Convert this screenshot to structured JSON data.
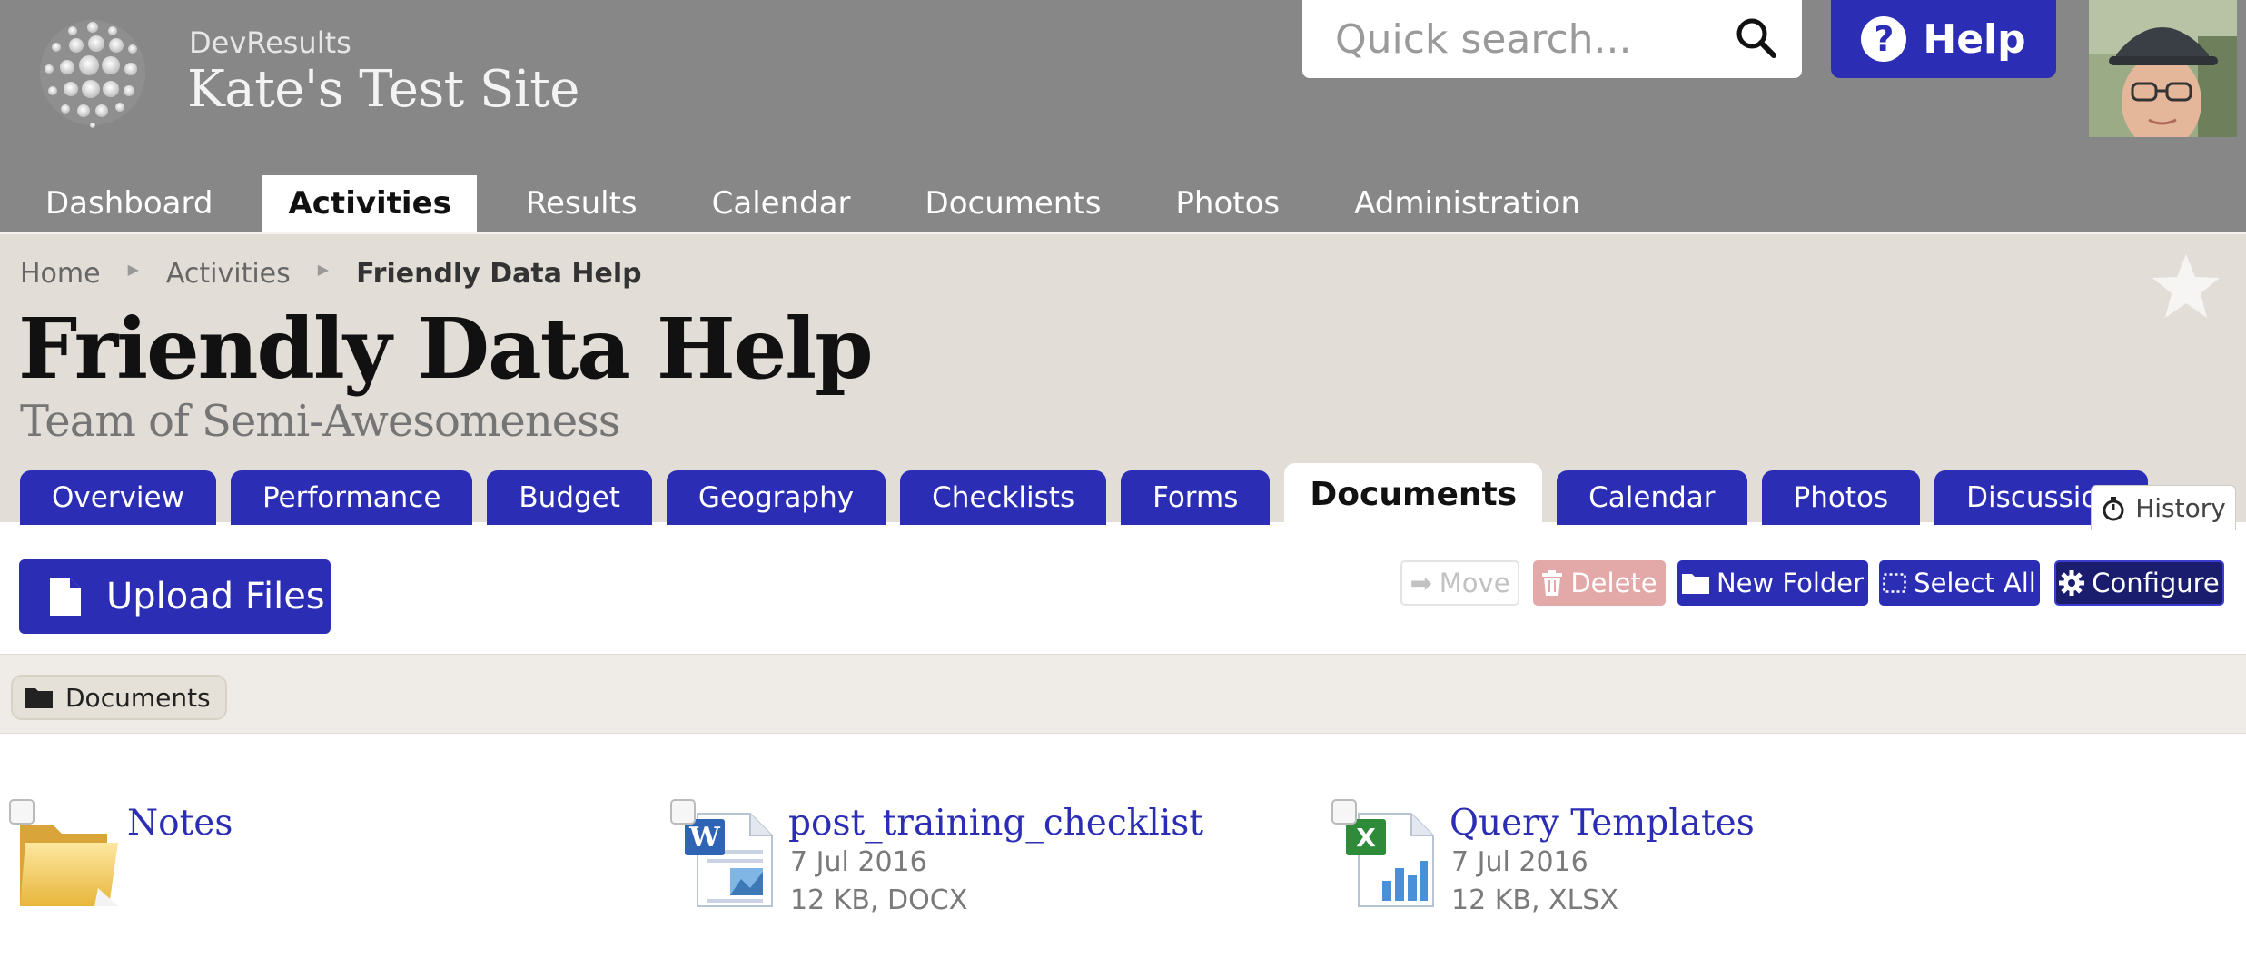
{
  "header": {
    "org_name": "DevResults",
    "site_title": "Kate's Test Site",
    "search": {
      "placeholder": "Quick search..."
    },
    "help_label": "Help"
  },
  "main_nav": [
    {
      "label": "Dashboard",
      "active": false
    },
    {
      "label": "Activities",
      "active": true
    },
    {
      "label": "Results",
      "active": false
    },
    {
      "label": "Calendar",
      "active": false
    },
    {
      "label": "Documents",
      "active": false
    },
    {
      "label": "Photos",
      "active": false
    },
    {
      "label": "Administration",
      "active": false
    }
  ],
  "breadcrumb": [
    "Home",
    "Activities",
    "Friendly Data Help"
  ],
  "page": {
    "title": "Friendly Data Help",
    "subtitle": "Team of Semi-Awesomeness"
  },
  "tabs": [
    {
      "label": "Overview",
      "active": false
    },
    {
      "label": "Performance",
      "active": false
    },
    {
      "label": "Budget",
      "active": false
    },
    {
      "label": "Geography",
      "active": false
    },
    {
      "label": "Checklists",
      "active": false
    },
    {
      "label": "Forms",
      "active": false
    },
    {
      "label": "Documents",
      "active": true
    },
    {
      "label": "Calendar",
      "active": false
    },
    {
      "label": "Photos",
      "active": false
    },
    {
      "label": "Discussion",
      "active": false
    }
  ],
  "history_label": "History",
  "toolbar": {
    "upload_label": "Upload Files",
    "move_label": "Move",
    "delete_label": "Delete",
    "new_folder_label": "New Folder",
    "select_all_label": "Select All",
    "configure_label": "Configure"
  },
  "folder_path": "Documents",
  "files": [
    {
      "name": "Notes",
      "type": "folder",
      "date": "",
      "meta": "",
      "icon": "folder-icon"
    },
    {
      "name": "post_training_checklist",
      "type": "docx",
      "date": "7 Jul 2016",
      "meta": "12 KB, DOCX",
      "icon": "word-document-icon"
    },
    {
      "name": "Query Templates",
      "type": "xlsx",
      "date": "7 Jul 2016",
      "meta": "12 KB, XLSX",
      "icon": "excel-spreadsheet-icon"
    }
  ],
  "colors": {
    "header_bg": "#878787",
    "brand_blue": "#2b2db5",
    "heading_bg": "#e3ddd7",
    "delete_disabled": "#e3a9a9"
  }
}
